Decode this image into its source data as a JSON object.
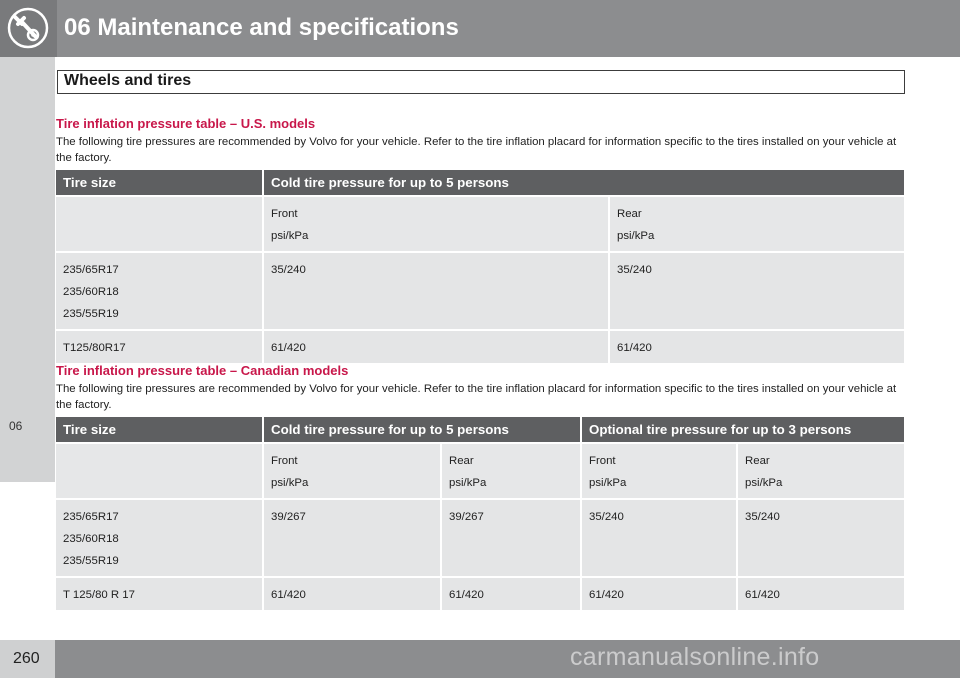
{
  "header": {
    "title": "06 Maintenance and specifications",
    "icon": "wrench-gear-icon"
  },
  "rail": {
    "tab_label": "06"
  },
  "section": {
    "title": "Wheels and tires"
  },
  "us": {
    "heading": "Tire inflation pressure table – U.S. models",
    "paragraph": "The following tire pressures are recommended by Volvo for your vehicle. Refer to the tire inflation placard for information specific to the tires installed on your vehicle at the factory.",
    "columns": [
      "Tire size",
      "Cold tire pressure for up to 5 persons"
    ],
    "subheader": {
      "front": "Front",
      "rear": "Rear",
      "unit": "psi/kPa"
    },
    "rows": [
      {
        "sizes": [
          "235/65R17",
          "235/60R18",
          "235/55R19"
        ],
        "front": "35/240",
        "rear": "35/240"
      },
      {
        "sizes": [
          "T125/80R17"
        ],
        "front": "61/420",
        "rear": "61/420"
      }
    ]
  },
  "canada": {
    "heading": "Tire inflation pressure table – Canadian models",
    "paragraph": "The following tire pressures are recommended by Volvo for your vehicle. Refer to the tire inflation placard for information specific to the tires installed on your vehicle at the factory.",
    "columns": [
      "Tire size",
      "Cold tire pressure for up to 5 persons",
      "Optional tire pressure for up to 3 persons"
    ],
    "subheader": {
      "front": "Front",
      "rear": "Rear",
      "unit": "psi/kPa"
    },
    "rows": [
      {
        "sizes": [
          "235/65R17",
          "235/60R18",
          "235/55R19"
        ],
        "values": [
          "39/267",
          "39/267",
          "35/240",
          "35/240"
        ]
      },
      {
        "sizes": [
          "T 125/80 R 17"
        ],
        "values": [
          "61/420",
          "61/420",
          "61/420",
          "61/420"
        ]
      }
    ]
  },
  "footer": {
    "page_number": "260",
    "watermark": "carmanualsonline.info"
  }
}
